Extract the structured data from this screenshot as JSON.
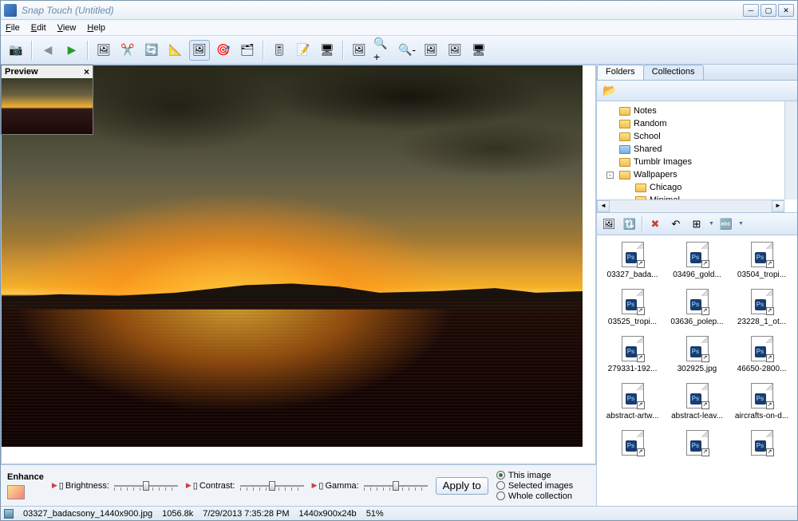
{
  "window": {
    "title": "Snap Touch (Untitled)"
  },
  "menu": {
    "file": "File",
    "edit": "Edit",
    "view": "View",
    "help": "Help"
  },
  "preview": {
    "title": "Preview"
  },
  "tabs": {
    "folders": "Folders",
    "collections": "Collections"
  },
  "tree": {
    "items": [
      {
        "label": "Notes",
        "type": "folder"
      },
      {
        "label": "Random",
        "type": "folder"
      },
      {
        "label": "School",
        "type": "folder"
      },
      {
        "label": "Shared",
        "type": "shared"
      },
      {
        "label": "Tumblr Images",
        "type": "folder"
      },
      {
        "label": "Wallpapers",
        "type": "folder",
        "expanded": true
      }
    ],
    "children": [
      {
        "label": "Chicago"
      },
      {
        "label": "Minimal"
      }
    ]
  },
  "files": [
    [
      "03327_bada...",
      "03496_gold...",
      "03504_tropi..."
    ],
    [
      "03525_tropi...",
      "03636_polep...",
      "23228_1_ot..."
    ],
    [
      "279331-192...",
      "302925.jpg",
      "46650-2800..."
    ],
    [
      "abstract-artw...",
      "abstract-leav...",
      "aircrafts-on-d..."
    ],
    [
      "",
      "",
      ""
    ]
  ],
  "enhance": {
    "label": "Enhance",
    "brightness": "Brightness:",
    "contrast": "Contrast:",
    "gamma": "Gamma:",
    "apply": "Apply to",
    "radio": {
      "this": "This image",
      "selected": "Selected images",
      "whole": "Whole collection"
    }
  },
  "status": {
    "filename": "03327_badacsony_1440x900.jpg",
    "size": "1056.8k",
    "date": "7/29/2013 7:35:28 PM",
    "dims": "1440x900x24b",
    "zoom": "51%"
  }
}
